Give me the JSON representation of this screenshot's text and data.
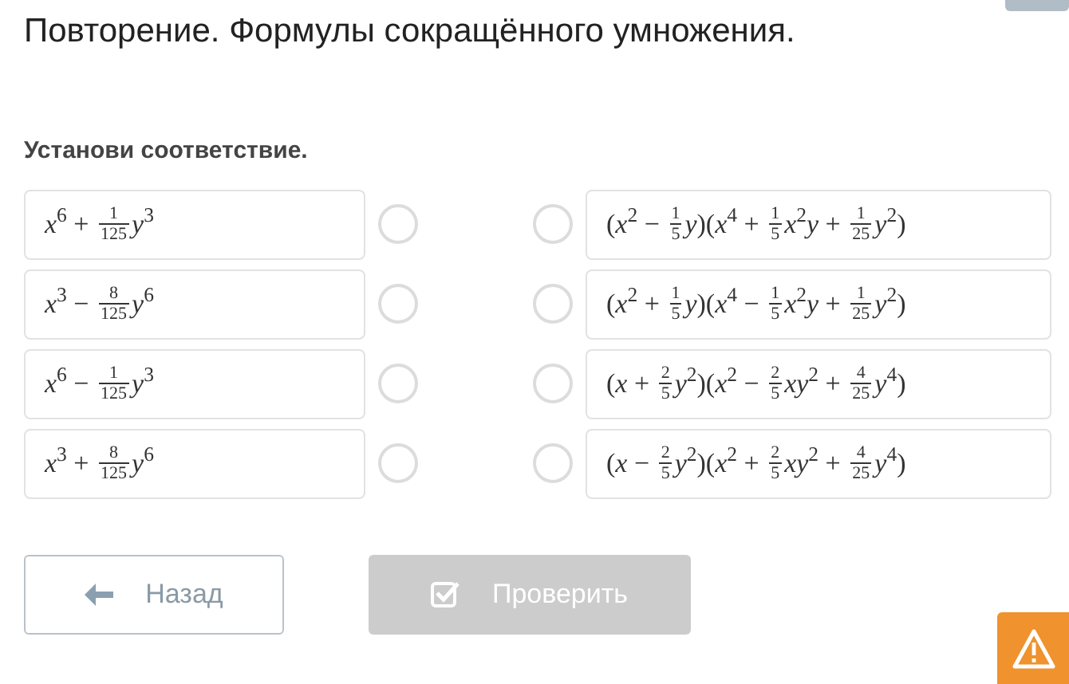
{
  "title": "Повторение. Формулы сокращённого умножения.",
  "instruction": "Установи соответствие.",
  "left": [
    {
      "selected": false,
      "formula": [
        {
          "kind": "text",
          "text": "*x*$^{6}$ + "
        },
        {
          "kind": "frac",
          "num": "1",
          "den": "125"
        },
        {
          "kind": "text",
          "text": "*y*$^{3}$"
        }
      ]
    },
    {
      "selected": false,
      "formula": [
        {
          "kind": "text",
          "text": "*x*$^{3}$ − "
        },
        {
          "kind": "frac",
          "num": "8",
          "den": "125"
        },
        {
          "kind": "text",
          "text": "*y*$^{6}$"
        }
      ]
    },
    {
      "selected": false,
      "formula": [
        {
          "kind": "text",
          "text": "*x*$^{6}$ − "
        },
        {
          "kind": "frac",
          "num": "1",
          "den": "125"
        },
        {
          "kind": "text",
          "text": "*y*$^{3}$"
        }
      ]
    },
    {
      "selected": false,
      "formula": [
        {
          "kind": "text",
          "text": "*x*$^{3}$ + "
        },
        {
          "kind": "frac",
          "num": "8",
          "den": "125"
        },
        {
          "kind": "text",
          "text": "*y*$^{6}$"
        }
      ]
    }
  ],
  "right": [
    {
      "selected": false,
      "formula": [
        {
          "kind": "text",
          "text": "(*x*$^{2}$ − "
        },
        {
          "kind": "frac",
          "num": "1",
          "den": "5"
        },
        {
          "kind": "text",
          "text": "*y*)(*x*$^{4}$ + "
        },
        {
          "kind": "frac",
          "num": "1",
          "den": "5"
        },
        {
          "kind": "text",
          "text": "*x*$^{2}$*y* + "
        },
        {
          "kind": "frac",
          "num": "1",
          "den": "25"
        },
        {
          "kind": "text",
          "text": "*y*$^{2}$)"
        }
      ]
    },
    {
      "selected": false,
      "formula": [
        {
          "kind": "text",
          "text": "(*x*$^{2}$ + "
        },
        {
          "kind": "frac",
          "num": "1",
          "den": "5"
        },
        {
          "kind": "text",
          "text": "*y*)(*x*$^{4}$ − "
        },
        {
          "kind": "frac",
          "num": "1",
          "den": "5"
        },
        {
          "kind": "text",
          "text": "*x*$^{2}$*y* + "
        },
        {
          "kind": "frac",
          "num": "1",
          "den": "25"
        },
        {
          "kind": "text",
          "text": "*y*$^{2}$)"
        }
      ]
    },
    {
      "selected": false,
      "formula": [
        {
          "kind": "text",
          "text": "(*x* + "
        },
        {
          "kind": "frac",
          "num": "2",
          "den": "5"
        },
        {
          "kind": "text",
          "text": "*y*$^{2}$)(*x*$^{2}$ − "
        },
        {
          "kind": "frac",
          "num": "2",
          "den": "5"
        },
        {
          "kind": "text",
          "text": "*xy*$^{2}$ + "
        },
        {
          "kind": "frac",
          "num": "4",
          "den": "25"
        },
        {
          "kind": "text",
          "text": "*y*$^{4}$)"
        }
      ]
    },
    {
      "selected": false,
      "formula": [
        {
          "kind": "text",
          "text": "(*x* − "
        },
        {
          "kind": "frac",
          "num": "2",
          "den": "5"
        },
        {
          "kind": "text",
          "text": "*y*$^{2}$)(*x*$^{2}$ + "
        },
        {
          "kind": "frac",
          "num": "2",
          "den": "5"
        },
        {
          "kind": "text",
          "text": "*xy*$^{2}$ + "
        },
        {
          "kind": "frac",
          "num": "4",
          "den": "25"
        },
        {
          "kind": "text",
          "text": "*y*$^{4}$)"
        }
      ]
    }
  ],
  "buttons": [
    {
      "kind": "back",
      "label": "Назад",
      "disabled": false
    },
    {
      "kind": "check",
      "label": "Проверить",
      "disabled": true
    }
  ]
}
